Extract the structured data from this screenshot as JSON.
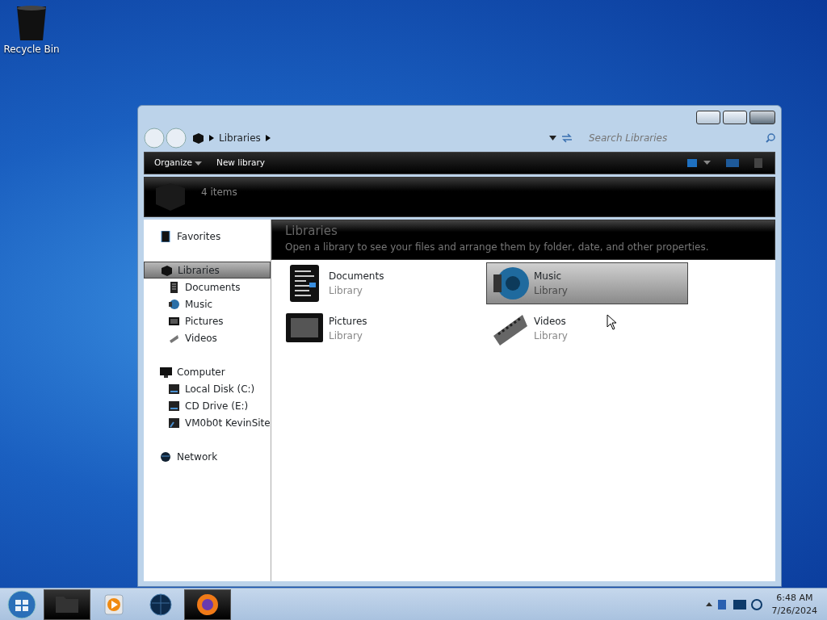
{
  "desktop_icons": [
    {
      "label": "Recycle Bin"
    }
  ],
  "window": {
    "address": {
      "segments": [
        "Libraries"
      ]
    },
    "search": {
      "placeholder": "Search Libraries"
    },
    "toolbar": [
      {
        "label": "Organize",
        "dropdown": true
      },
      {
        "label": "New library",
        "dropdown": false
      }
    ],
    "details": {
      "text": "4 items"
    },
    "navigation": [
      {
        "label": "Favorites",
        "kind": "star",
        "selected": false
      },
      {
        "label": "Libraries",
        "kind": "library",
        "selected": true,
        "children": [
          {
            "label": "Documents",
            "kind": "document",
            "selected": false
          },
          {
            "label": "Music",
            "kind": "music",
            "selected": false
          },
          {
            "label": "Pictures",
            "kind": "picture",
            "selected": false
          },
          {
            "label": "Videos",
            "kind": "video",
            "selected": false
          }
        ]
      },
      {
        "label": "Computer",
        "kind": "computer",
        "selected": false,
        "children": [
          {
            "label": "Local Disk (C:)",
            "kind": "disk",
            "selected": false
          },
          {
            "label": "CD Drive (E:)",
            "kind": "disk",
            "selected": false
          },
          {
            "label": "VM0b0t KevinSite",
            "kind": "share",
            "selected": false
          }
        ]
      },
      {
        "label": "Network",
        "kind": "network",
        "selected": false
      }
    ],
    "content": {
      "title": "Libraries",
      "subtitle": "Open a library to see your files and arrange them by folder, date, and other properties.",
      "items": [
        {
          "name": "Documents",
          "type": "Library",
          "kind": "document",
          "selected": false
        },
        {
          "name": "Music",
          "type": "Library",
          "kind": "music",
          "selected": true
        },
        {
          "name": "Pictures",
          "type": "Library",
          "kind": "picture",
          "selected": false
        },
        {
          "name": "Videos",
          "type": "Library",
          "kind": "video",
          "selected": false
        }
      ]
    }
  },
  "taskbar": {
    "items": [
      {
        "kind": "explorer",
        "active": true
      },
      {
        "kind": "media",
        "active": false
      },
      {
        "kind": "globe",
        "active": false
      },
      {
        "kind": "firefox",
        "active": true
      }
    ],
    "time": "6:48 AM",
    "date": "7/26/2024"
  }
}
